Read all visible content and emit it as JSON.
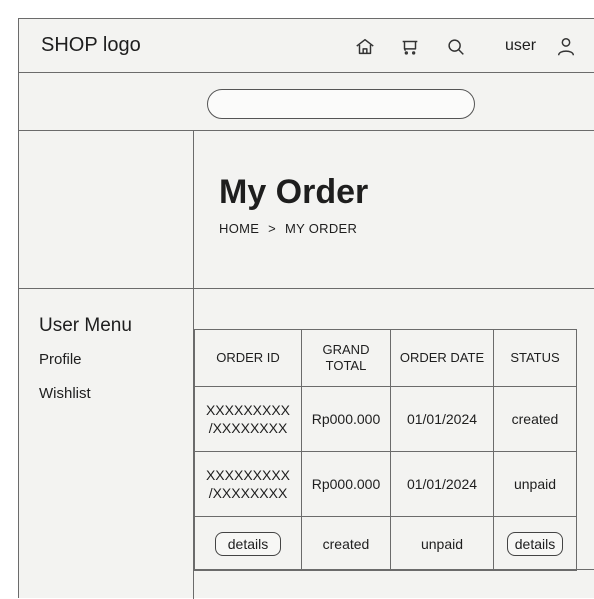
{
  "header": {
    "logo": "SHOP logo",
    "icons": [
      "home-icon",
      "cart-icon",
      "search-icon",
      "user-icon"
    ],
    "user_label": "user"
  },
  "search": {
    "value": "",
    "placeholder": ""
  },
  "page": {
    "title": "My Order",
    "breadcrumb": [
      "HOME",
      ">",
      "MY ORDER"
    ]
  },
  "user_menu": {
    "title": "User Menu",
    "items": [
      "Profile",
      "Wishlist"
    ]
  },
  "orders": {
    "headers": [
      "ORDER ID",
      "GRAND\nTOTAL",
      "ORDER DATE",
      "STATUS"
    ],
    "rows": [
      {
        "order_id_1": "XXXXXXXXX",
        "order_id_2": "/XXXXXXXX",
        "total": "Rp000.000",
        "date": "01/01/2024",
        "status": "created"
      },
      {
        "order_id_1": "XXXXXXXXX",
        "order_id_2": "/XXXXXXXX",
        "total": "Rp000.000",
        "date": "01/01/2024",
        "status": "unpaid"
      }
    ],
    "footer_row": [
      "details",
      "created",
      "unpaid",
      "details"
    ]
  }
}
